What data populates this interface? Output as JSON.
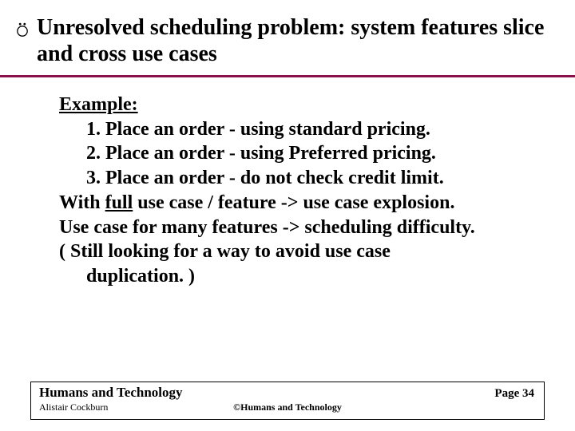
{
  "title": "Unresolved scheduling problem: system features slice and cross use cases",
  "example": {
    "label": "Example:",
    "items": [
      "1. Place an order - using standard pricing.",
      "2. Place an order - using Preferred pricing.",
      "3. Place an order - do not check credit limit."
    ]
  },
  "lines": {
    "with_prefix": "With ",
    "with_underlined": "full",
    "with_suffix": " use case / feature -> use case explosion.",
    "use_case_line": "Use case for many features -> scheduling difficulty."
  },
  "note": {
    "line1": "( Still looking for a way to avoid use case",
    "line2": "duplication. )"
  },
  "footer": {
    "org": "Humans and Technology",
    "author": "Alistair Cockburn",
    "copyright": "©Humans and Technology",
    "page": "Page 34"
  },
  "colors": {
    "rule": "#8a0f4a"
  }
}
